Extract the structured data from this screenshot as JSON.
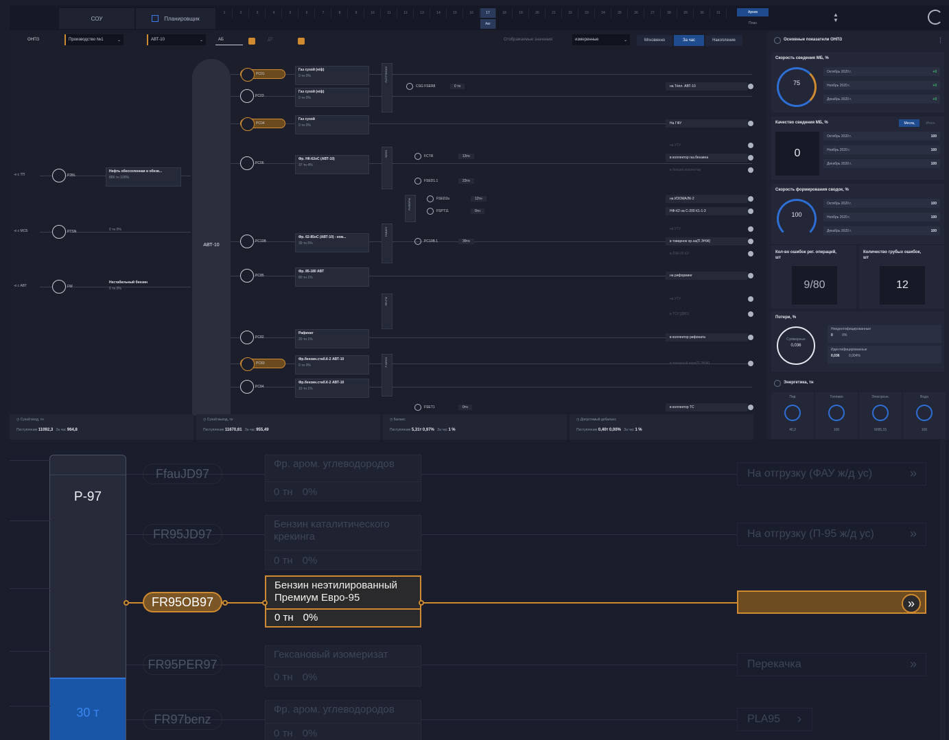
{
  "topbar": {
    "tab1": "СОУ",
    "tab2": "Планировщик",
    "timeline": [
      "1",
      "2",
      "3",
      "4",
      "5",
      "6",
      "7",
      "8",
      "9",
      "10",
      "11",
      "12",
      "13",
      "14",
      "15",
      "16",
      "17",
      "18",
      "19",
      "20",
      "21",
      "22",
      "23",
      "24",
      "25",
      "26",
      "27",
      "28",
      "29",
      "30",
      "31"
    ],
    "timeline_selected": "17",
    "timeline_selected_sub": "Авг",
    "toggle1": "Архив",
    "toggle2": "План"
  },
  "controls": {
    "plant": "ОНПЗ",
    "unit_select": "Производство №1",
    "sub_select": "АВТ-10",
    "tab_a": "АБ",
    "tab_b": "ДТ",
    "display_label": "Отображаемые значения:",
    "display_value": "измеренные",
    "seg": [
      "Мгновенно",
      "За час",
      "Накопление"
    ],
    "seg_active": "За час"
  },
  "scheme": {
    "column_label": "АВТ-10",
    "sources": [
      {
        "label": "с ТП",
        "node": "P2BL",
        "circle": "БРН",
        "product": "Нефть обессоленная и обезв...",
        "val": "865 тн  100%"
      },
      {
        "label": "с МСБ",
        "node": "PTSN",
        "circle": "",
        "product": "",
        "val": "0 тн  0%"
      },
      {
        "label": "с АВТ",
        "node": "FW",
        "circle": "",
        "product": "Нестабильный бензин",
        "val": "0 тн  0%"
      }
    ],
    "outputs": [
      {
        "node": "PC01",
        "active": true,
        "product": "Газ сухой (н/ф)",
        "val": "0 тн  0%"
      },
      {
        "node": "PC03",
        "active": false,
        "product": "Газ сухой (н/ф)",
        "val": "0 тн  0%"
      },
      {
        "node": "PC04",
        "active": true,
        "product": "Газ сухой",
        "val": "0 тн  0%"
      },
      {
        "node": "PC06",
        "active": false,
        "product": "Фр. НК-62оС (АВТ-10)",
        "val": "37 тн  4%"
      },
      {
        "node": "PC10B",
        "active": false,
        "product": "Фр. 62-85оС (АВТ-10) - ком...",
        "val": "39 тн  5%"
      },
      {
        "node": "PC85",
        "active": false,
        "product": "Фр. 85-180 АВТ",
        "val": "80 тн  1%"
      },
      {
        "node": "PC82",
        "active": false,
        "product": "Рафинат",
        "val": "20 тн  1%"
      },
      {
        "node": "PC83",
        "active": true,
        "product": "Фр.бензин.стаб.К-2 АВТ-10",
        "val": "0 тн  0%"
      },
      {
        "node": "PC84",
        "active": false,
        "product": "Фр.бензин.стаб.К-2 АВТ-10",
        "val": "10 тн  1%"
      }
    ],
    "groups": [
      "FLOTTAGAS",
      "БЕНЗ",
      "FABAIS",
      "РИФОРМ",
      "RE-FM",
      "Р-БЕНЗ"
    ],
    "mids": [
      {
        "label": "CSG   FSER8",
        "val": "0 тн"
      },
      {
        "label": "FCTR",
        "val": "13тн"
      },
      {
        "label": "FSED1.1",
        "val": "23тн"
      },
      {
        "label": "FSED2a",
        "val": "12тн"
      },
      {
        "label": "FSPT11",
        "val": "0тн"
      },
      {
        "label": "PC10B.1",
        "val": "39тн"
      },
      {
        "label": "FSET1",
        "val": "0тн"
      }
    ],
    "dests": [
      {
        "label": "на Тёпл. АВТ-10",
        "dim": false
      },
      {
        "label": "На ГФУ",
        "dim": false
      },
      {
        "label": "на УТУ",
        "dim": true
      },
      {
        "label": "в коллектор газ.бензина",
        "dim": false
      },
      {
        "label": "в бензин.коллектор",
        "dim": true
      },
      {
        "label": "на ИЗОМАЛК-2",
        "dim": false
      },
      {
        "label": "НФ-К2 на С-200 К1-1-3",
        "dim": false
      },
      {
        "label": "на УТУ",
        "dim": true
      },
      {
        "label": "в товарное хр.на(П.ЭНЖ)",
        "dim": false
      },
      {
        "label": "в ЛЗК-35 КУ",
        "dim": true
      },
      {
        "label": "на риформинг",
        "dim": false
      },
      {
        "label": "на УТУ",
        "dim": true
      },
      {
        "label": "в ТСУ.(ДВО)",
        "dim": true
      },
      {
        "label": "в коллектор рифоната",
        "dim": false
      },
      {
        "label": "в товарный парк(П.ЭНЖ)",
        "dim": true
      },
      {
        "label": "в коллектор ТС",
        "dim": false
      }
    ]
  },
  "statusbar": [
    {
      "title": "Сухой вход, тн",
      "k1": "Поступление",
      "v1": "11092,3",
      "k2": "За час",
      "v2": "964,8"
    },
    {
      "title": "Сухой выход, тн",
      "k1": "Поступление",
      "v1": "11670,61",
      "k2": "За час",
      "v2": "955,49"
    },
    {
      "title": "Баланс",
      "k1": "Поступление",
      "v1": "5,31т",
      "v1b": "0,97%",
      "k2": "За час",
      "v2": "1",
      "v2b": "%"
    },
    {
      "title": "Допустимый дебаланс",
      "k1": "Поступление",
      "v1": "0,40т",
      "v1b": "0,00%",
      "k2": "За час",
      "v2": "1",
      "v2b": "%"
    }
  ],
  "right": {
    "header": "Основные показатели ОНПЗ",
    "kpi1_title": "Скорость сведения МБ, %",
    "kpi1_value": "75",
    "kpi1_rows": [
      {
        "m": "Октябрь 2020 г.",
        "v": "+0"
      },
      {
        "m": "Ноябрь 2020 г.",
        "v": "+0"
      },
      {
        "m": "Декабрь 2020 г.",
        "v": "+0"
      }
    ],
    "kpi2_title": "Качество сведения МБ, %",
    "kpi2_tabs": [
      "Месяц",
      "Итого"
    ],
    "kpi2_value": "0",
    "kpi2_rows": [
      {
        "m": "Октябрь 2020 г.",
        "v": "100"
      },
      {
        "m": "Ноябрь 2020 г.",
        "v": "100"
      },
      {
        "m": "Декабрь 2020 г.",
        "v": "100"
      }
    ],
    "kpi3_title": "Скорость формирования сводок, %",
    "kpi3_value": "100",
    "kpi3_rows": [
      {
        "m": "Октябрь 2020 г.",
        "v": "100"
      },
      {
        "m": "Ноябрь 2020 г.",
        "v": "100"
      },
      {
        "m": "Декабрь 2020 г.",
        "v": "100"
      }
    ],
    "kpi4_title": "Кол-во ошибок рег. операций, шт",
    "kpi4_value": "9/80",
    "kpi5_title": "Количество грубых ошибок, шт",
    "kpi5_value": "12",
    "loss_title": "Потери, %",
    "loss_center": "Суммарные",
    "loss_value": "0,036",
    "loss_row1_label": "Неидентифицированные",
    "loss_row1_val": "0",
    "loss_row1_pct": "0%",
    "loss_row2_label": "Идентифицированные",
    "loss_row2_val": "0,036",
    "loss_row2_pct": "0,004%",
    "energy_title": "Энергетика, тн",
    "energy": [
      {
        "name": "Пар",
        "val": "40,2"
      },
      {
        "name": "Топливо",
        "val": "100"
      },
      {
        "name": "Электроэн.",
        "val": "6095,15"
      },
      {
        "name": "Вода",
        "val": "100"
      }
    ]
  },
  "bottom": {
    "tank_name": "Р-97",
    "tank_level": "30 т",
    "tank_fill_fraction": 0.22,
    "rows": [
      {
        "node": "FfauJD97",
        "active": false,
        "product": "Фр. аром. углеводородов",
        "qty": "0 тн",
        "pct": "0%",
        "dest": "На отгрузку (ФАУ ж/д ус)",
        "chev": "»",
        "dest_w": "full"
      },
      {
        "node": "FR95JD97",
        "active": false,
        "product": "Бензин каталитического крекинга",
        "qty": "0 тн",
        "pct": "0%",
        "dest": "На отгрузку (П-95 ж/д ус)",
        "chev": "»",
        "dest_w": "full"
      },
      {
        "node": "FR95OB97",
        "active": true,
        "product": "Бензин неэтилированный Премиум Евро-95",
        "qty": "0 тн",
        "pct": "0%",
        "dest": "",
        "chev": "»",
        "dest_w": "full"
      },
      {
        "node": "FR95PER97",
        "active": false,
        "product": "Гексановый изомеризат",
        "qty": "0 тн",
        "pct": "0%",
        "dest": "Перекачка",
        "chev": "»",
        "dest_w": "full"
      },
      {
        "node": "FR97benz",
        "active": false,
        "product": "Фр. аром. углеводородов",
        "qty": "0 тн",
        "pct": "0%",
        "dest": "PLA95",
        "chev": "›",
        "dest_w": "short"
      }
    ]
  }
}
